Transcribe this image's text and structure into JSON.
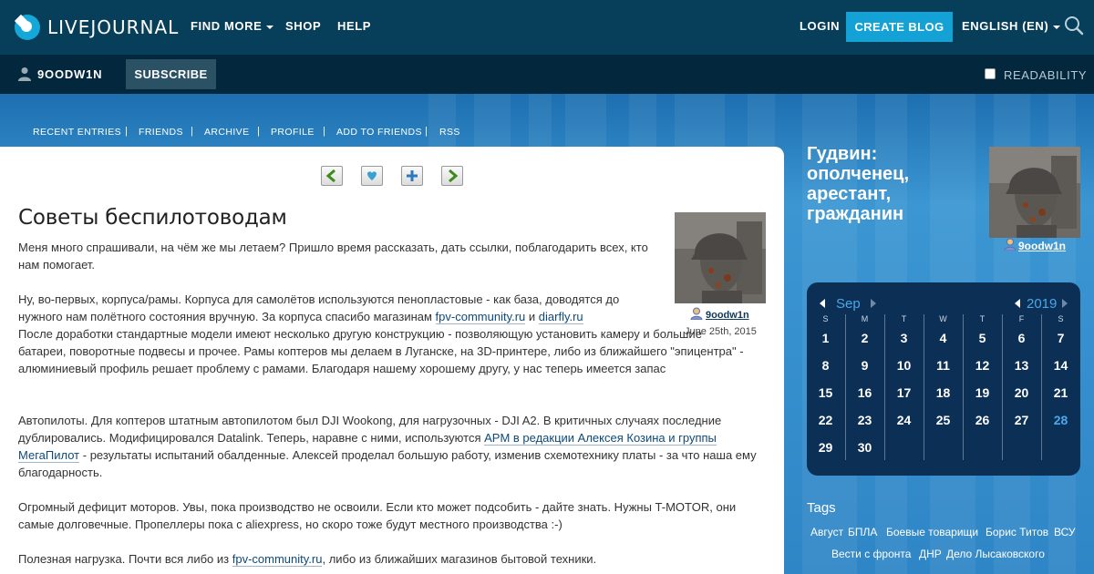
{
  "header": {
    "logo_text": "LIVEJOURNAL",
    "find_more": "FIND MORE",
    "shop": "SHOP",
    "help": "HELP",
    "login": "LOGIN",
    "create_blog": "CREATE BLOG",
    "language": "ENGLISH (EN)"
  },
  "subbar": {
    "username": "9OODW1N",
    "subscribe": "SUBSCRIBE",
    "readability": "READABILITY"
  },
  "journal_menu": [
    "RECENT ENTRIES",
    "FRIENDS",
    "ARCHIVE",
    "PROFILE",
    "ADD TO FRIENDS",
    "RSS"
  ],
  "post": {
    "title": "Советы беспилотоводам",
    "author": "9oodw1n",
    "date": "June 25th, 2015",
    "p1": "Меня много спрашивали, на чём же мы летаем? Пришло время рассказать, дать ссылки, поблагодарить всех, кто нам помогает.",
    "p2_text": "Ну, во-первых, корпуса/рамы. Корпуса для самолётов используются пенопластовые - как база, доводятся до нужного нам полётного состояния вручную. За корпуса спасибо магазинам ",
    "link_fpv": "fpv-community.ru",
    "and": " и ",
    "link_diarfly": "diarfly.ru",
    "p2_b": "После доработки стандартные модели имеют несколько другую конструкцию - позволяющую установить камеру и большие батареи, поворотные подвесы и прочее. Рамы коптеров мы делаем в Луганске, на 3D-принтере, либо из ближайшего \"эпицентра\" - алюминиевый профиль решает проблему с рамами. Благодаря нашему хорошему другу, у нас теперь имеется запас",
    "p3_a": "Автопилоты. Для коптеров штатным автопилотом был DJI Wookong, для нагрузочных - DJI A2. В критичных случаях последние дублировались. Модифицировался Datalink. Теперь, наравне с ними, используются ",
    "link_apm": "APM в редакции Алексея Козина и группы МегаПилот",
    "p3_b": " - результаты испытаний обалденные. Алексей проделал большую работу, изменив схемотехнику платы - за что наша ему благодарность.",
    "p4": "Огромный дефицит моторов. Увы, пока производство не освоили. Если кто может подсобить - дайте знать. Нужны T-MOTOR, они самые долговечные. Пропеллеры пока с aliexpress, но скоро тоже будут местного производства :-)",
    "p5_a": "Полезная нагрузка. Почти вся либо из ",
    "p5_b": ", либо из ближайших магазинов бытовой техники."
  },
  "sidebar": {
    "blog_title": "Гудвин: ополченец, арестант, гражданин",
    "username": "9oodw1n"
  },
  "calendar": {
    "month": "Sep",
    "year": "2019",
    "weekdays": [
      "S",
      "M",
      "T",
      "W",
      "T",
      "F",
      "S"
    ],
    "days": [
      "1",
      "2",
      "3",
      "4",
      "5",
      "6",
      "7",
      "8",
      "9",
      "10",
      "11",
      "12",
      "13",
      "14",
      "15",
      "16",
      "17",
      "18",
      "19",
      "20",
      "21",
      "22",
      "23",
      "24",
      "25",
      "26",
      "27",
      "28",
      "29",
      "30"
    ],
    "highlight_day": "28",
    "highlight_color": "#4aa8e8"
  },
  "tags": {
    "title": "Tags",
    "items": [
      "Август",
      "БПЛА",
      "Боевые товарищи",
      "Борис Титов",
      "ВСУ",
      "Вести с фронта",
      "ДНР",
      "Дело Лысаковского"
    ]
  },
  "colors": {
    "topbar": "#073f5a",
    "subbar": "#03283d",
    "accent": "#14a2d6",
    "background": "#2f86c6"
  }
}
